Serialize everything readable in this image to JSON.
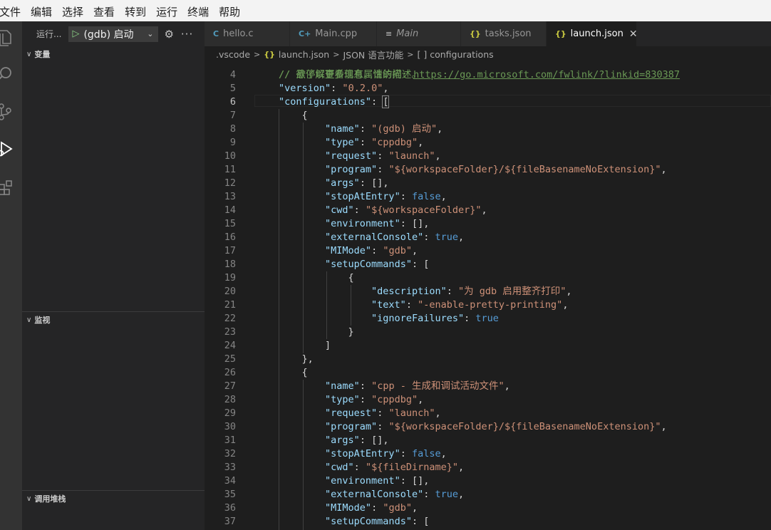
{
  "menubar": [
    "文件",
    "编辑",
    "选择",
    "查看",
    "转到",
    "运行",
    "终端",
    "帮助"
  ],
  "sidebar": {
    "run_label": "运行...",
    "config_name": "(gdb) 启动",
    "panels": {
      "variables": "变量",
      "watch": "监视",
      "call_stack": "调用堆栈"
    }
  },
  "tabs": [
    {
      "icon": "C",
      "label": "hello.c"
    },
    {
      "icon": "C+",
      "label": "Main.cpp"
    },
    {
      "icon": "≡",
      "label": "Main"
    },
    {
      "icon": "{}",
      "label": "tasks.json"
    },
    {
      "icon": "{}",
      "label": "launch.json"
    }
  ],
  "breadcrumb": {
    "folder": ".vscode",
    "file": "launch.json",
    "feature": "JSON 语言功能",
    "node_icon": "[ ]",
    "node": "configurations"
  },
  "code": {
    "line3_partial": "// 悬停以查看现有属性的描述。",
    "line4_comment": "// 欲了解更多信息，请访问: ",
    "line4_url": "https://go.microsoft.com/fwlink/?linkid=830387",
    "version": "0.2.0",
    "config1": {
      "name": "(gdb) 启动",
      "type": "cppdbg",
      "request": "launch",
      "program": "${workspaceFolder}/${fileBasenameNoExtension}",
      "cwd": "${workspaceFolder}",
      "stopAtEntry": "false",
      "externalConsole": "true",
      "MIMode": "gdb",
      "setup_description": "为 gdb 启用整齐打印",
      "setup_text": "-enable-pretty-printing",
      "ignoreFailures": "true"
    },
    "config2": {
      "name": "cpp - 生成和调试活动文件",
      "type": "cppdbg",
      "request": "launch",
      "program": "${workspaceFolder}/${fileBasenameNoExtension}",
      "stopAtEntry": "false",
      "cwd": "${fileDirname}",
      "externalConsole": "true",
      "MIMode": "gdb"
    },
    "line_numbers": [
      "4",
      "5",
      "6",
      "7",
      "8",
      "9",
      "10",
      "11",
      "12",
      "13",
      "14",
      "15",
      "16",
      "17",
      "18",
      "19",
      "20",
      "21",
      "22",
      "23",
      "24",
      "25",
      "26",
      "27",
      "28",
      "29",
      "30",
      "31",
      "32",
      "33",
      "34",
      "35",
      "36",
      "37"
    ],
    "current_line": "6"
  }
}
